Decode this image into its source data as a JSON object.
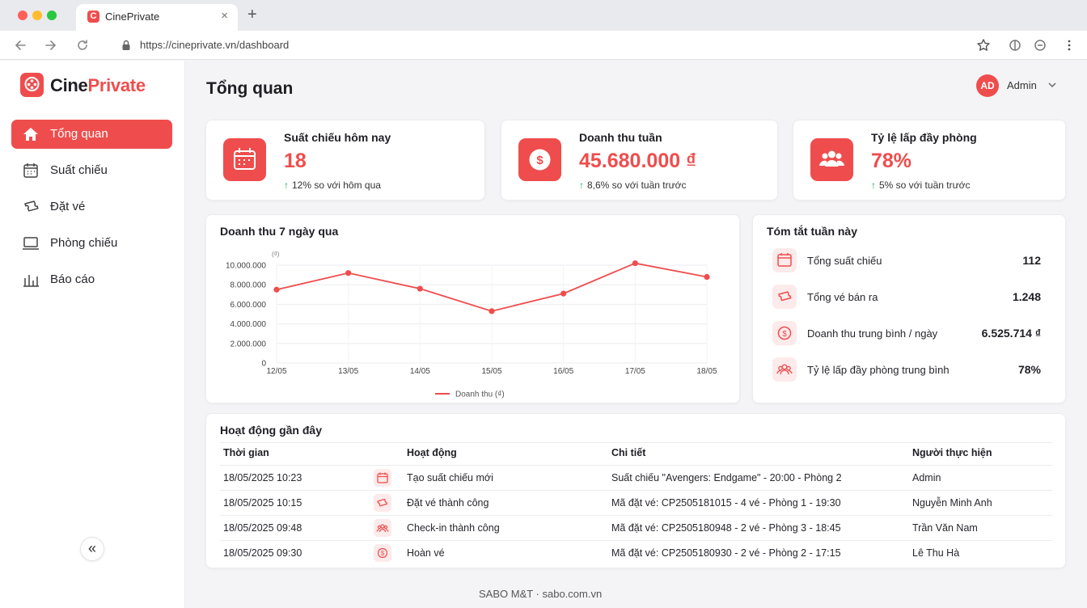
{
  "browser": {
    "tab_title": "CinePrivate",
    "url": "https://cineprivate.vn/dashboard",
    "favicon_letter": "C"
  },
  "brand": {
    "name_part1": "Cine",
    "name_part2": "Private",
    "accent": "#ef4d4d"
  },
  "sidebar": {
    "items": [
      {
        "label": "Tổng quan",
        "icon": "home-icon",
        "active": true
      },
      {
        "label": "Suất chiếu",
        "icon": "calendar-icon",
        "active": false
      },
      {
        "label": "Đặt vé",
        "icon": "ticket-icon",
        "active": false
      },
      {
        "label": "Phòng chiếu",
        "icon": "monitor-icon",
        "active": false
      },
      {
        "label": "Báo cáo",
        "icon": "bar-chart-icon",
        "active": false
      }
    ],
    "collapse_label": "«"
  },
  "header": {
    "title": "Tổng quan",
    "user_initials": "AD",
    "user_name": "Admin"
  },
  "stats": [
    {
      "label": "Suất chiếu hôm nay",
      "value": "18",
      "arrow": "↑",
      "delta": "12% so với hôm qua",
      "icon": "calendar-icon"
    },
    {
      "label": "Doanh thu tuần",
      "value": "45.680.000 ₫",
      "arrow": "↑",
      "delta": "8,6% so với tuần trước",
      "icon": "dollar-icon"
    },
    {
      "label": "Tỷ lệ lấp đầy phòng",
      "value": "78%",
      "arrow": "↑",
      "delta": "5% so với tuần trước",
      "icon": "users-icon"
    }
  ],
  "chart_card": {
    "title": "Doanh thu 7 ngày qua"
  },
  "chart_data": {
    "type": "line",
    "title": "Doanh thu 7 ngày qua",
    "unit_label": "(₫)",
    "categories": [
      "12/05",
      "13/05",
      "14/05",
      "15/05",
      "16/05",
      "17/05",
      "18/05"
    ],
    "series": [
      {
        "name": "Doanh thu (₫)",
        "values": [
          7500000,
          9200000,
          7600000,
          5300000,
          7100000,
          10200000,
          8800000
        ]
      }
    ],
    "yticks": [
      "10.000.000",
      "8.000.000",
      "6.000.000",
      "4.000.000",
      "2.000.000",
      "0"
    ],
    "ylim": [
      0,
      10000000
    ],
    "grid": true,
    "legend": "bottom",
    "color": "#ef4d4d"
  },
  "summary": {
    "title": "Tóm tắt tuần này",
    "rows": [
      {
        "label": "Tổng suất chiếu",
        "value": "112",
        "icon": "calendar-icon"
      },
      {
        "label": "Tổng vé bán ra",
        "value": "1.248",
        "icon": "ticket-icon"
      },
      {
        "label": "Doanh thu trung bình / ngày",
        "value": "6.525.714 ₫",
        "icon": "dollar-icon"
      },
      {
        "label": "Tỷ lệ lấp đầy phòng trung bình",
        "value": "78%",
        "icon": "users-icon"
      }
    ]
  },
  "activity": {
    "title": "Hoạt động gần đây",
    "columns": [
      "Thời gian",
      "Hoạt động",
      "Chi tiết",
      "Người thực hiện"
    ],
    "rows": [
      {
        "time": "18/05/2025 10:23",
        "icon": "calendar-icon",
        "action": "Tạo suất chiếu mới",
        "detail": "Suất chiếu \"Avengers: Endgame\" - 20:00 - Phòng 2",
        "user": "Admin"
      },
      {
        "time": "18/05/2025 10:15",
        "icon": "ticket-icon",
        "action": "Đặt vé thành công",
        "detail": "Mã đặt vé: CP2505181015 - 4 vé - Phòng 1 - 19:30",
        "user": "Nguyễn Minh Anh"
      },
      {
        "time": "18/05/2025 09:48",
        "icon": "users-icon",
        "action": "Check-in thành công",
        "detail": "Mã đặt vé: CP2505180948 - 2 vé - Phòng 3 - 18:45",
        "user": "Trần Văn Nam"
      },
      {
        "time": "18/05/2025 09:30",
        "icon": "dollar-icon",
        "action": "Hoàn vé",
        "detail": "Mã đặt vé: CP2505180930 - 2 vé - Phòng 2 - 17:15",
        "user": "Lê Thu Hà"
      }
    ]
  },
  "footer": {
    "text": "SABO M&T · sabo.com.vn"
  }
}
